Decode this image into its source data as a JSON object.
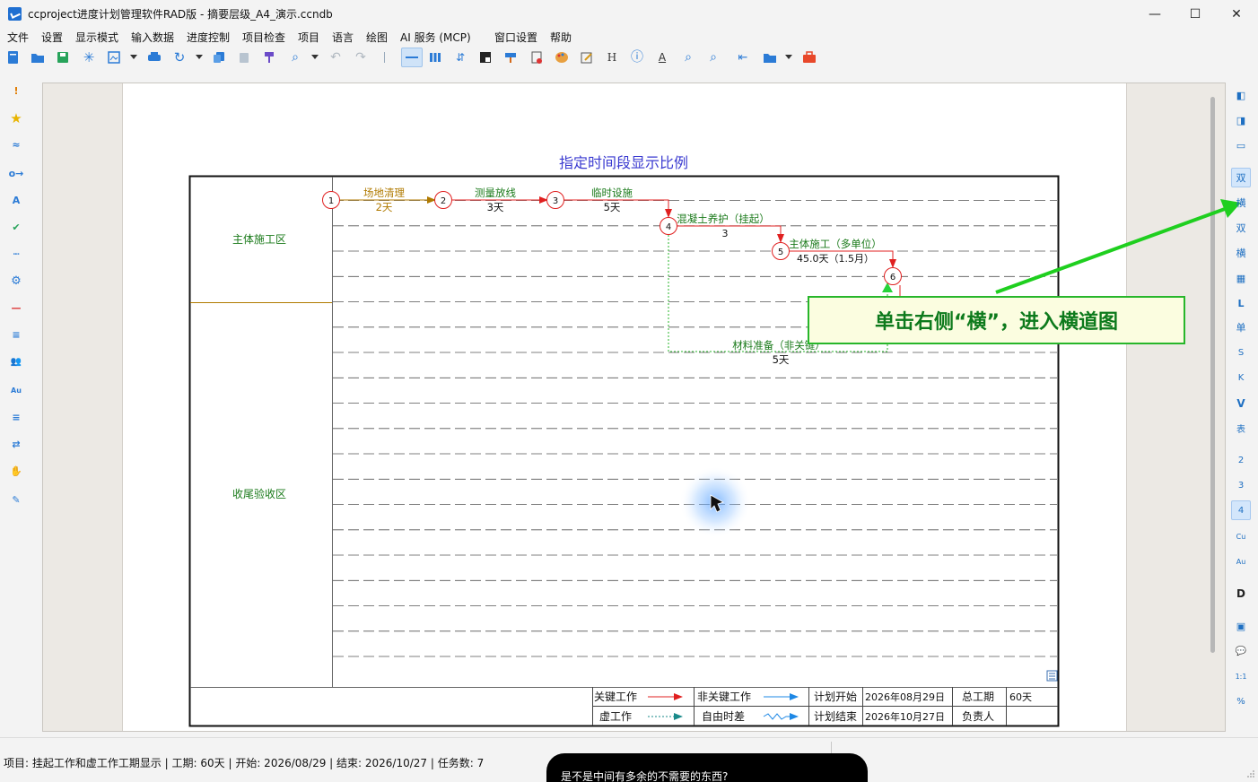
{
  "window": {
    "title": "ccproject进度计划管理软件RAD版 - 摘要层级_A4_演示.ccndb",
    "minimize_glyph": "—",
    "maximize_glyph": "☐",
    "close_glyph": "✕"
  },
  "menu": {
    "items": [
      "文件",
      "设置",
      "显示模式",
      "输入数据",
      "进度控制",
      "项目检查",
      "项目",
      "语言",
      "绘图",
      "AI 服务 (MCP)",
      "窗口设置",
      "帮助"
    ]
  },
  "toolbar": {
    "icons": [
      "new-doc-icon",
      "open-folder-icon",
      "save-icon",
      "snowflake-icon",
      "image-export-icon",
      "print-icon",
      "refresh-icon",
      "copy-icon",
      "paste-icon",
      "format-brush-icon",
      "search-icon",
      "undo-icon",
      "redo-icon",
      "line-view-icon",
      "bar-view-icon",
      "sort-icon",
      "contrast-icon",
      "paint-icon",
      "report-icon",
      "palette-icon",
      "edit-form-icon",
      "heading-icon",
      "info-icon",
      "text-style-icon",
      "zoom-out-icon",
      "zoom-in-icon",
      "back-icon",
      "folder-icon",
      "briefcase-icon"
    ],
    "h_label": "H"
  },
  "left_toolbar": {
    "glyphs": [
      "!",
      "★",
      "≈",
      "o→",
      "A",
      "✔",
      "┉",
      "⚙",
      "—",
      "≡",
      "👥",
      "Au",
      "≡",
      "⇄",
      "✋",
      "✎"
    ]
  },
  "right_toolbar": {
    "items": [
      "◧",
      "◨",
      "▭",
      "双",
      "横",
      "双",
      "横",
      "▦",
      "L",
      "单",
      "S",
      "K",
      "V",
      "表",
      "2",
      "3",
      "4",
      "Cu",
      "Au",
      "D",
      "▣",
      "💬",
      "1:1",
      "%"
    ]
  },
  "chart": {
    "title": "指定时间段显示比例",
    "zones": [
      "主体施工区",
      "收尾验收区"
    ],
    "nodes": [
      "1",
      "2",
      "3",
      "4",
      "5",
      "6"
    ],
    "tasks": [
      {
        "name": "场地清理",
        "duration": "2天"
      },
      {
        "name": "测量放线",
        "duration": "3天"
      },
      {
        "name": "临时设施",
        "duration": "5天"
      },
      {
        "name": "混凝土养护（挂起）",
        "duration": "3"
      },
      {
        "name": "主体施工（多单位）",
        "duration": "45.0天（1.5月）"
      },
      {
        "name": "材料准备（非关键）",
        "duration": "5天"
      }
    ],
    "legend": {
      "critical": "关键工作",
      "non_critical": "非关键工作",
      "dummy": "虚工作",
      "free_float": "自由时差",
      "plan_start_label": "计划开始",
      "plan_start_value": "2026年08月29日",
      "total_duration_label": "总工期",
      "total_duration_value": "60天",
      "plan_end_label": "计划结束",
      "plan_end_value": "2026年10月27日",
      "owner_label": "负责人",
      "owner_value": ""
    },
    "colors": {
      "critical": "#e02020",
      "non_critical": "#1e88e5",
      "zone_text": "#1a7a1a",
      "title": "#3a3ad0",
      "orange_text": "#b07a00"
    }
  },
  "callout": {
    "text": "单击右侧“横”，进入横道图"
  },
  "status": {
    "text": "项目: 挂起工作和虚工作工期显示 | 工期: 60天 | 开始: 2026/08/29 | 结束: 2026/10/27 | 任务数: 7",
    "tooltip": "是不是中间有多余的不需要的东西?"
  }
}
